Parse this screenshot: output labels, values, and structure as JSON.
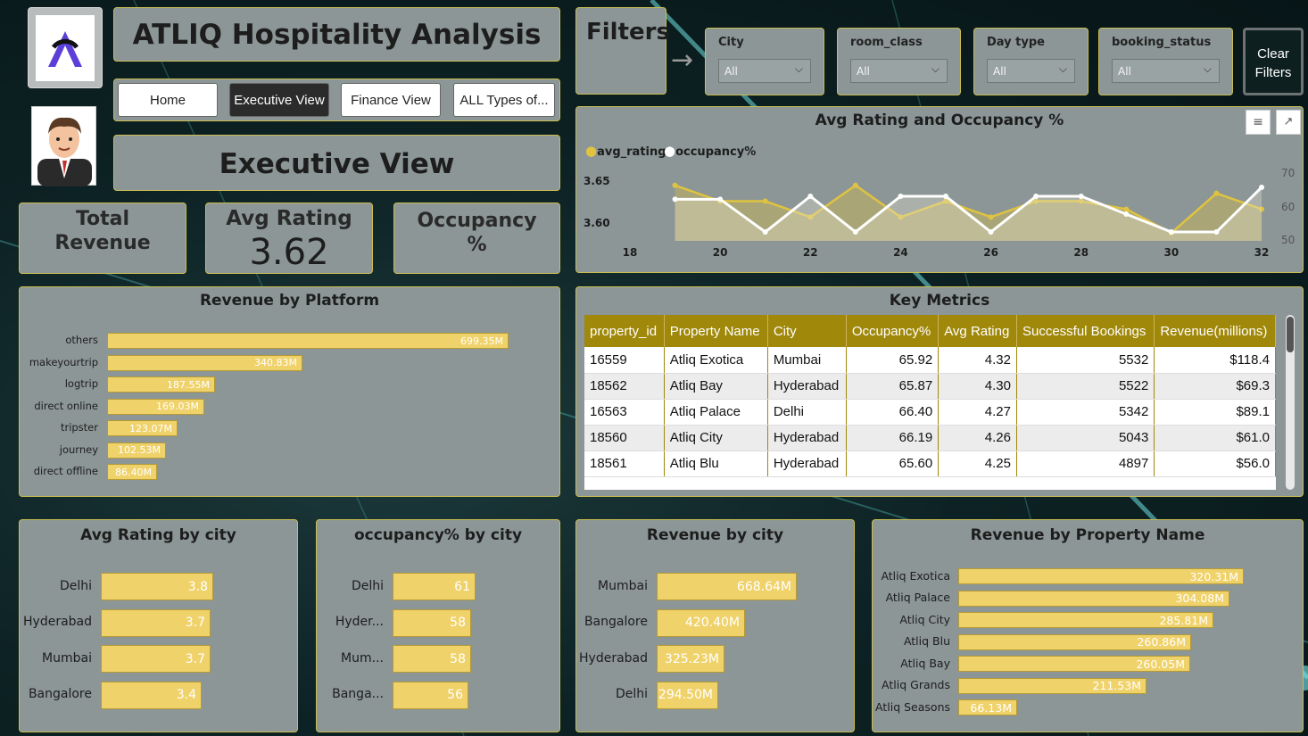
{
  "header": {
    "title": "ATLIQ Hospitality Analysis",
    "page_title": "Executive View"
  },
  "nav": {
    "buttons": [
      {
        "label": "Home",
        "active": false
      },
      {
        "label": "Executive View",
        "active": true
      },
      {
        "label": "Finance View",
        "active": false
      },
      {
        "label": "ALL Types of...",
        "active": false
      }
    ]
  },
  "filters": {
    "title": "Filters",
    "items": [
      {
        "label": "City",
        "value": "All"
      },
      {
        "label": "room_class",
        "value": "All"
      },
      {
        "label": "Day type",
        "value": "All"
      },
      {
        "label": "booking_status",
        "value": "All"
      }
    ],
    "clear_label_1": "Clear",
    "clear_label_2": "Filters"
  },
  "kpis": {
    "total_revenue_label_1": "Total",
    "total_revenue_label_2": "Revenue",
    "avg_rating_label": "Avg Rating",
    "avg_rating_value": "3.62",
    "occupancy_label_1": "Occupancy",
    "occupancy_label_2": "%"
  },
  "line_chart": {
    "title": "Avg Rating and Occupancy %",
    "legend": [
      "avg_rating",
      "occupancy%"
    ],
    "y_left_ticks": [
      "3.65",
      "3.60"
    ],
    "y_right_ticks": [
      "70",
      "60",
      "50"
    ],
    "x_ticks": [
      "18",
      "20",
      "22",
      "24",
      "26",
      "28",
      "30",
      "32"
    ]
  },
  "key_metrics": {
    "title": "Key Metrics",
    "columns": [
      "property_id",
      "Property Name",
      "City",
      "Occupancy%",
      "Avg Rating",
      "Successful Bookings",
      "Revenue(millions)"
    ],
    "rows": [
      [
        "16559",
        "Atliq Exotica",
        "Mumbai",
        "65.92",
        "4.32",
        "5532",
        "$118.4"
      ],
      [
        "18562",
        "Atliq Bay",
        "Hyderabad",
        "65.87",
        "4.30",
        "5522",
        "$69.3"
      ],
      [
        "16563",
        "Atliq Palace",
        "Delhi",
        "66.40",
        "4.27",
        "5342",
        "$89.1"
      ],
      [
        "18560",
        "Atliq City",
        "Hyderabad",
        "66.19",
        "4.26",
        "5043",
        "$61.0"
      ],
      [
        "18561",
        "Atliq Blu",
        "Hyderabad",
        "65.60",
        "4.25",
        "4897",
        "$56.0"
      ]
    ]
  },
  "colors": {
    "accent_gold": "#f0d26a",
    "header_gold": "#a0880a",
    "panel_bg": "#8c9696",
    "occupancy_line": "#ffffff",
    "rating_line": "#e0c340"
  },
  "chart_data": [
    {
      "type": "line",
      "title": "Avg Rating and Occupancy %",
      "x": [
        19,
        20,
        21,
        22,
        23,
        24,
        25,
        26,
        27,
        28,
        29,
        30,
        31,
        32
      ],
      "xlim": [
        18,
        32
      ],
      "series": [
        {
          "name": "avg_rating",
          "axis": "left",
          "values": [
            3.65,
            3.63,
            3.63,
            3.61,
            3.65,
            3.61,
            3.63,
            3.61,
            3.63,
            3.63,
            3.62,
            3.59,
            3.64,
            3.62
          ]
        },
        {
          "name": "occupancy%",
          "axis": "right",
          "values": [
            62,
            62,
            51,
            63,
            51,
            63,
            63,
            51,
            63,
            63,
            57,
            51,
            51,
            66
          ]
        }
      ],
      "ylim_left": [
        3.58,
        3.67
      ],
      "ylim_right": [
        48,
        72
      ]
    },
    {
      "type": "bar",
      "title": "Revenue by Platform",
      "categories": [
        "others",
        "makeyourtrip",
        "logtrip",
        "direct online",
        "tripster",
        "journey",
        "direct offline"
      ],
      "values": [
        699.35,
        340.83,
        187.55,
        169.03,
        123.07,
        102.53,
        86.4
      ],
      "labels": [
        "699.35M",
        "340.83M",
        "187.55M",
        "169.03M",
        "123.07M",
        "102.53M",
        "86.40M"
      ]
    },
    {
      "type": "bar",
      "title": "Avg Rating by city",
      "categories": [
        "Delhi",
        "Hyderabad",
        "Mumbai",
        "Bangalore"
      ],
      "values": [
        3.8,
        3.7,
        3.7,
        3.4
      ],
      "labels": [
        "3.8",
        "3.7",
        "3.7",
        "3.4"
      ]
    },
    {
      "type": "bar",
      "title": "occupancy% by city",
      "categories": [
        "Delhi",
        "Hyder...",
        "Mum...",
        "Banga..."
      ],
      "values": [
        61,
        58,
        58,
        56
      ],
      "labels": [
        "61",
        "58",
        "58",
        "56"
      ]
    },
    {
      "type": "bar",
      "title": "Revenue by city",
      "categories": [
        "Mumbai",
        "Bangalore",
        "Hyderabad",
        "Delhi"
      ],
      "values": [
        668.64,
        420.4,
        325.23,
        294.5
      ],
      "labels": [
        "668.64M",
        "420.40M",
        "325.23M",
        "294.50M"
      ]
    },
    {
      "type": "bar",
      "title": "Revenue by Property Name",
      "categories": [
        "Atliq Exotica",
        "Atliq Palace",
        "Atliq City",
        "Atliq Blu",
        "Atliq Bay",
        "Atliq Grands",
        "Atliq Seasons"
      ],
      "values": [
        320.31,
        304.08,
        285.81,
        260.86,
        260.05,
        211.53,
        66.13
      ],
      "labels": [
        "320.31M",
        "304.08M",
        "285.81M",
        "260.86M",
        "260.05M",
        "211.53M",
        "66.13M"
      ]
    }
  ]
}
